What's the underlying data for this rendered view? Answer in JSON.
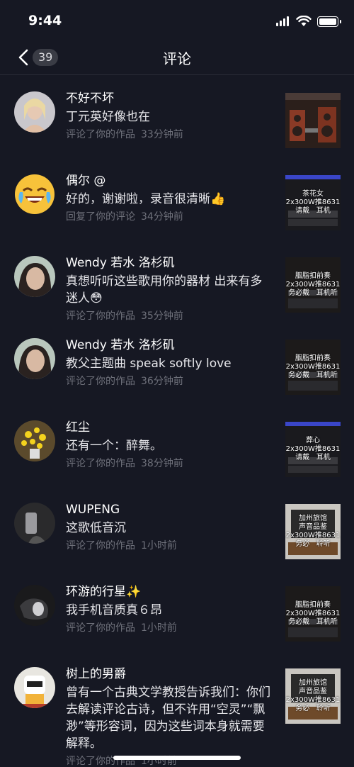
{
  "status_bar": {
    "time": "9:44"
  },
  "header": {
    "count": "39",
    "title": "评论"
  },
  "notifications": [
    {
      "username": "不好不坏",
      "comment": "丁元英好像也在",
      "action": "评论了你的作品",
      "time": "33分钟前",
      "thumb_text": ""
    },
    {
      "username": "偶尔 @",
      "comment": "好的，谢谢啦，录音很清晰👍",
      "action": "回复了你的评论",
      "time": "34分钟前",
      "thumb_text": "茶花女\n2x300W推8631\n请戴   耳机"
    },
    {
      "username": "Wendy 若水 洛杉矶",
      "comment": "真想听听这些歌用你的器材 出来有多迷人😳",
      "action": "评论了你的作品",
      "time": "35分钟前",
      "thumb_text": "胭脂扣前奏\n2x300W推8631\n务必戴   耳机听"
    },
    {
      "username": "Wendy 若水 洛杉矶",
      "comment": "教父主题曲 speak softly love",
      "action": "评论了你的作品",
      "time": "36分钟前",
      "thumb_text": "胭脂扣前奏\n2x300W推8631\n务必戴   耳机听"
    },
    {
      "username": "红尘",
      "comment": "还有一个：醉舞。",
      "action": "评论了你的作品",
      "time": "38分钟前",
      "thumb_text": "葬心\n2x300W推8631\n请戴   耳机"
    },
    {
      "username": "WUPENG",
      "comment": "这歌低音沉",
      "action": "评论了你的作品",
      "time": "1小时前",
      "thumb_text": "加州旅馆\n声音品鉴\n2x300W推8631\n务必   聆听"
    },
    {
      "username": "环游的行星✨",
      "comment": "我手机音质真６昂",
      "action": "评论了你的作品",
      "time": "1小时前",
      "thumb_text": "胭脂扣前奏\n2x300W推8631\n务必戴   耳机听"
    },
    {
      "username": "树上的男爵",
      "comment": "曾有一个古典文学教授告诉我们：你们去解读评论古诗，但不许用“空灵”“飘渺”等形容词，因为这些词本身就需要解释。",
      "action": "评论了你的作品",
      "time": "1小时前",
      "thumb_text": "加州旅馆\n声音品鉴\n2x300W推8631\n务必   聆听"
    }
  ],
  "colors": {
    "background": "#161823",
    "meta_text": "#6f717b",
    "badge_bg": "#3a3c45"
  }
}
